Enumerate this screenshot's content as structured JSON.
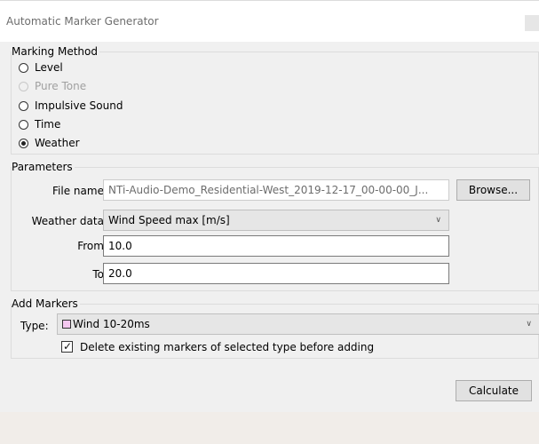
{
  "window": {
    "title": "Automatic Marker Generator"
  },
  "marking_method": {
    "legend": "Marking Method",
    "options": [
      {
        "label": "Level",
        "selected": false,
        "enabled": true
      },
      {
        "label": "Pure Tone",
        "selected": false,
        "enabled": false
      },
      {
        "label": "Impulsive Sound",
        "selected": false,
        "enabled": true
      },
      {
        "label": "Time",
        "selected": false,
        "enabled": true
      },
      {
        "label": "Weather",
        "selected": true,
        "enabled": true
      }
    ]
  },
  "parameters": {
    "legend": "Parameters",
    "file_name_label": "File name:",
    "file_name_value": "NTi-Audio-Demo_Residential-West_2019-12-17_00-00-00_J...",
    "browse_label": "Browse...",
    "weather_data_label": "Weather data:",
    "weather_data_value": "Wind Speed max [m/s]",
    "from_label": "From:",
    "from_value": "10.0",
    "to_label": "To:",
    "to_value": "20.0"
  },
  "add_markers": {
    "legend": "Add Markers",
    "type_label": "Type:",
    "type_value": "Wind 10-20ms",
    "type_swatch_color": "#f5c8f0",
    "delete_existing_label": "Delete existing markers of selected type before adding",
    "delete_existing_checked": true
  },
  "actions": {
    "calculate_label": "Calculate"
  },
  "icons": {
    "dropdown": "chevron-down-icon",
    "check": "checkmark-icon"
  }
}
